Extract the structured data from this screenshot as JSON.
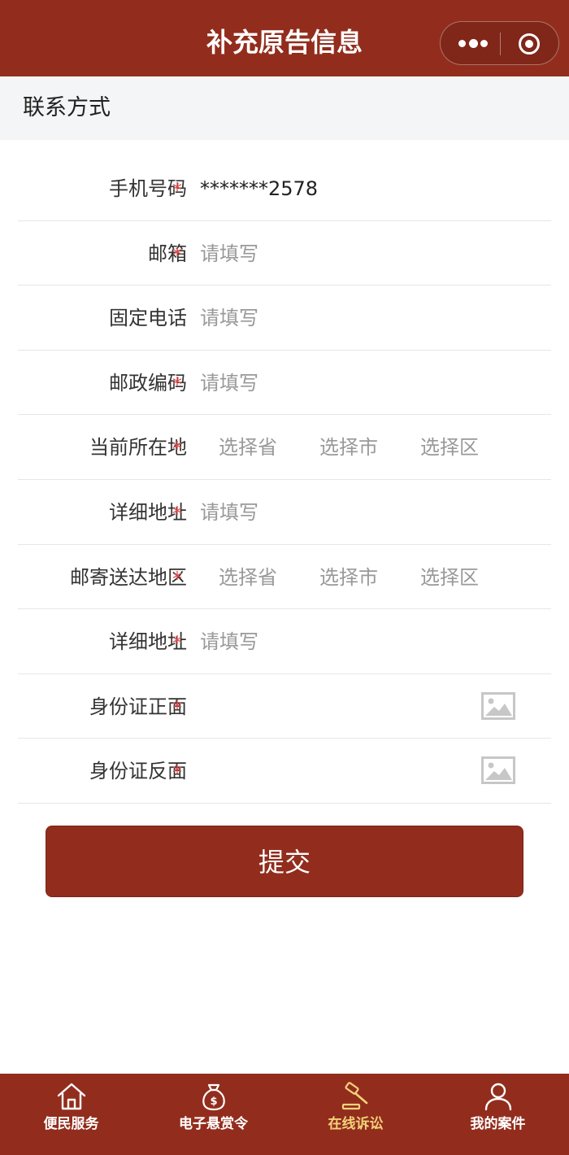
{
  "navbar": {
    "title": "补充原告信息"
  },
  "section": {
    "title": "联系方式"
  },
  "form": {
    "phone": {
      "label": "手机号码",
      "required": "*",
      "value": "*******2578"
    },
    "email": {
      "label": "邮箱",
      "required": "*",
      "placeholder": "请填写"
    },
    "landline": {
      "label": "固定电话",
      "placeholder": "请填写"
    },
    "postcode": {
      "label": "邮政编码",
      "required": "*",
      "placeholder": "请填写"
    },
    "current_location": {
      "label": "当前所在地",
      "required": "*",
      "province": "选择省",
      "city": "选择市",
      "district": "选择区"
    },
    "detail_address_1": {
      "label": "详细地址",
      "required": "*",
      "placeholder": "请填写"
    },
    "mail_region": {
      "label": "邮寄送达地区",
      "required": "*",
      "province": "选择省",
      "city": "选择市",
      "district": "选择区"
    },
    "detail_address_2": {
      "label": "详细地址",
      "required": "*",
      "placeholder": "请填写"
    },
    "id_front": {
      "label": "身份证正面",
      "required": "*",
      "icon": "image-upload-icon"
    },
    "id_back": {
      "label": "身份证反面",
      "required": "*",
      "icon": "image-upload-icon"
    }
  },
  "submit": {
    "label": "提交"
  },
  "tabbar": {
    "items": [
      {
        "label": "便民服务",
        "icon": "home-icon",
        "active": false
      },
      {
        "label": "电子悬赏令",
        "icon": "money-bag-icon",
        "active": false
      },
      {
        "label": "在线诉讼",
        "icon": "gavel-icon",
        "active": true
      },
      {
        "label": "我的案件",
        "icon": "user-icon",
        "active": false
      }
    ]
  },
  "colors": {
    "brand": "#922d1d",
    "required_star": "#e34b4b",
    "active_tab": "#f4d27a",
    "placeholder": "#999999"
  }
}
